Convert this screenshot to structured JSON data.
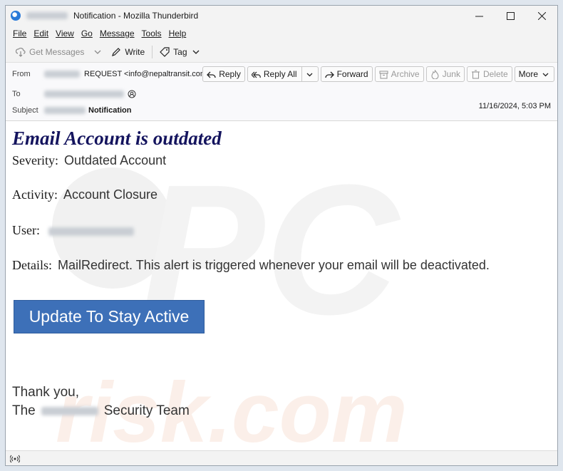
{
  "window": {
    "title": "Notification - Mozilla Thunderbird"
  },
  "menu": {
    "items": [
      {
        "label": "File"
      },
      {
        "label": "Edit"
      },
      {
        "label": "View"
      },
      {
        "label": "Go"
      },
      {
        "label": "Message"
      },
      {
        "label": "Tools"
      },
      {
        "label": "Help"
      }
    ]
  },
  "toolbar": {
    "get_messages": "Get Messages",
    "write": "Write",
    "tag": "Tag"
  },
  "header": {
    "from_label": "From",
    "from_value": "REQUEST <info@nepaltransit.com>",
    "to_label": "To",
    "subject_label": "Subject",
    "subject_value": "Notification",
    "date": "11/16/2024, 5:03 PM",
    "actions": {
      "reply": "Reply",
      "reply_all": "Reply All",
      "forward": "Forward",
      "archive": "Archive",
      "junk": "Junk",
      "delete": "Delete",
      "more": "More"
    }
  },
  "message": {
    "title": "Email Account is outdated",
    "severity_label": "Severity:",
    "severity_value": "Outdated Account",
    "activity_label": "Activity:",
    "activity_value": "Account Closure",
    "user_label": "User:",
    "details_label": "Details:",
    "details_value": "MailRedirect. This alert is triggered whenever your email will be deactivated.",
    "cta_label": "Update To Stay Active",
    "thanks": "Thank you,",
    "team_prefix": "The",
    "team_suffix": "Security Team"
  },
  "colors": {
    "title": "#14145e",
    "cta_bg": "#3d70b8",
    "cta_text": "#ffffff"
  },
  "icons": {
    "app": "thunderbird-icon",
    "status": "wireless-status-icon"
  }
}
